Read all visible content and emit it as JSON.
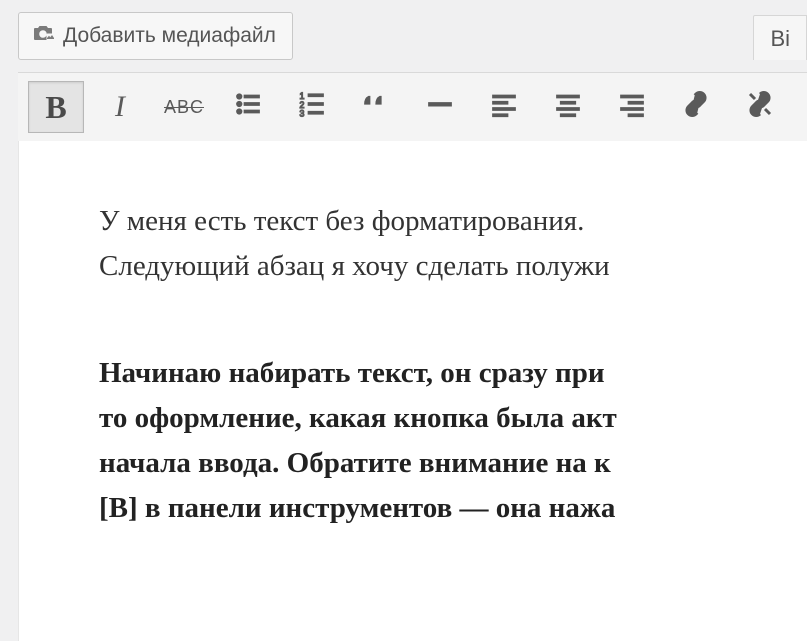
{
  "media_button": {
    "label": "Добавить медиафайл"
  },
  "tabs": {
    "visual": "Ві"
  },
  "toolbar": {
    "bold": "B",
    "italic": "I",
    "strike": "ABC"
  },
  "content": {
    "p1_line1": "У меня есть текст без форматирования.",
    "p1_line2": "Следующий абзац я хочу сделать полужи",
    "p2_line1": "Начинаю набирать текст, он сразу при",
    "p2_line2": "то оформление, какая кнопка была акт",
    "p2_line3": "начала ввода. Обратите внимание на к",
    "p2_line4": "[B] в панели инструментов — она нажа"
  }
}
